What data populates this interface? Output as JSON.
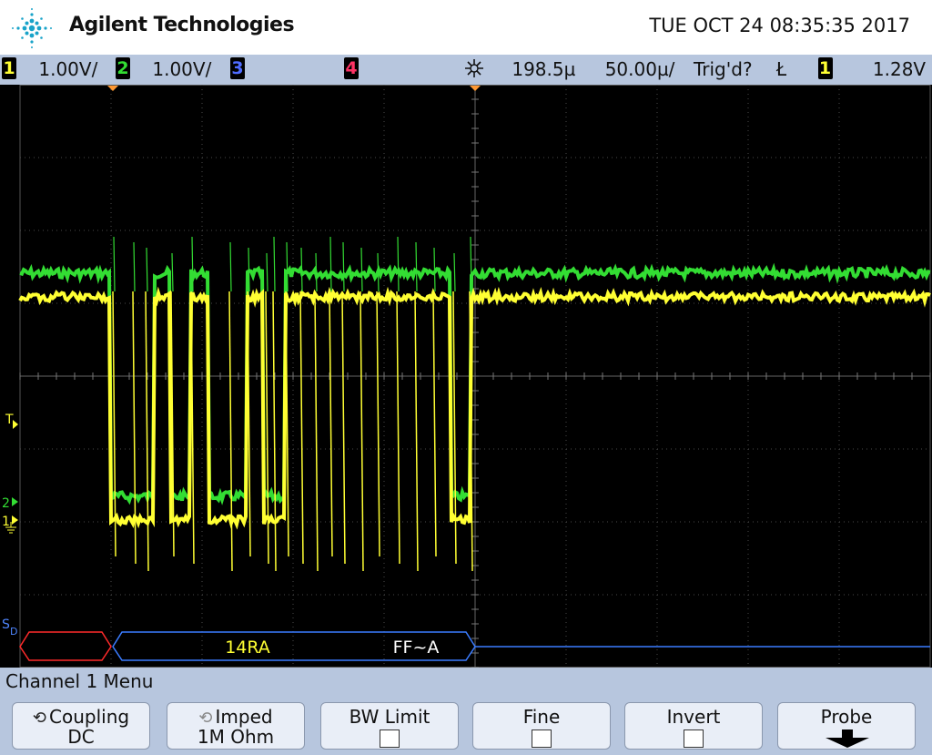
{
  "header": {
    "brand": "Agilent Technologies",
    "datetime": "TUE OCT 24 08:35:35 2017"
  },
  "status": {
    "ch1_num": "1",
    "ch1_scale": "1.00V/",
    "ch2_num": "2",
    "ch2_scale": "1.00V/",
    "ch3_num": "3",
    "ch4_num": "4",
    "time_delay": "198.5µ",
    "time_scale": "50.00µ/",
    "trigger_state": "Trig'd?",
    "trigger_slope": "Ł",
    "trigger_source": "1",
    "trigger_level": "1.28V"
  },
  "screen": {
    "marker_t": "T",
    "marker_2": "2",
    "marker_1": "1",
    "marker_sd": "S",
    "marker_sd_sub": "D",
    "decode_1": "14RA",
    "decode_2": "FF~A"
  },
  "menu": {
    "title": "Channel 1  Menu",
    "keys": [
      {
        "l1": "Coupling",
        "l2": "DC"
      },
      {
        "l1": "Imped",
        "l2": "1M Ohm"
      },
      {
        "l1": "BW Limit",
        "l2": ""
      },
      {
        "l1": "Fine",
        "l2": ""
      },
      {
        "l1": "Invert",
        "l2": ""
      },
      {
        "l1": "Probe",
        "l2": ""
      }
    ]
  },
  "colors": {
    "ch1": "#ffff33",
    "ch2": "#33dd33",
    "decode_frame": "#3a7cff",
    "decode_error": "#ff2a2a",
    "panel": "#b7c6de"
  }
}
